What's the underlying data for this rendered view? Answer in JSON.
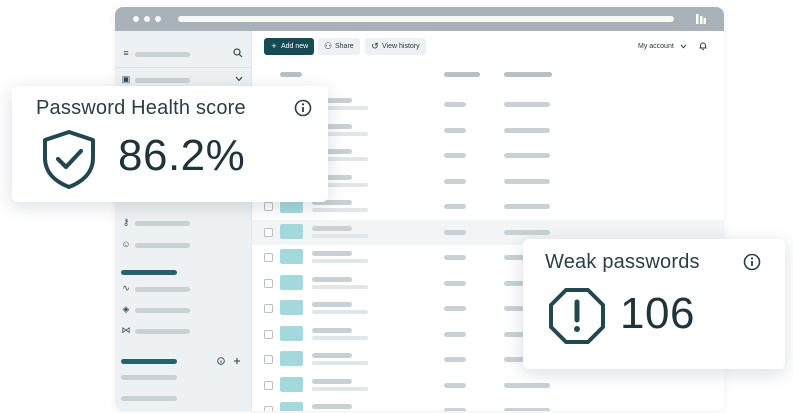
{
  "toolbar": {
    "add_new": "Add new",
    "share": "Share",
    "view_history": "View history",
    "account": "My account"
  },
  "icons": {
    "menu": "menu-icon",
    "search": "search-icon",
    "vault": "vault-icon",
    "chevron": "chevron-down-icon",
    "key": "key-icon",
    "contacts": "contacts-icon",
    "activity": "activity-icon",
    "box": "box-icon",
    "handshake": "handshake-icon",
    "info": "info-icon",
    "plus": "plus-icon",
    "bell": "bell-icon",
    "shield": "shield-check-icon",
    "warning": "octagon-warning-icon"
  },
  "cards": {
    "health": {
      "title": "Password Health score",
      "value": "86.2%"
    },
    "weak": {
      "title": "Weak passwords",
      "value": "106"
    }
  },
  "colors": {
    "accent": "#144b54",
    "thumb": "#a3d9dc",
    "titlebar": "#a9b2b8"
  }
}
